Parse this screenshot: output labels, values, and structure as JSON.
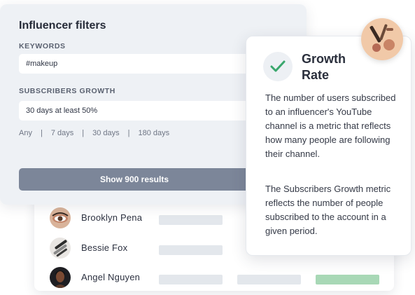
{
  "filters": {
    "title": "Influencer filters",
    "keywords_label": "KEYWORDS",
    "keywords_value": "#makeup",
    "growth_label": "SUBSCRIBERS GROWTH",
    "growth_value": "30 days at least 50%",
    "periods": [
      "Any",
      "7 days",
      "30 days",
      "180 days"
    ],
    "period_separator": "|",
    "show_button": "Show 900 results"
  },
  "influencers": [
    {
      "name": "Brooklyn Pena",
      "avatar_icon": "makeup-eye-photo-icon"
    },
    {
      "name": "Bessie Fox",
      "avatar_icon": "makeup-brush-photo-icon"
    },
    {
      "name": "Angel Nguyen",
      "avatar_icon": "woman-portrait-photo-icon"
    }
  ],
  "growth_card": {
    "icon": "check-icon",
    "title": "Growth Rate",
    "paragraph1": "The number of users subscribed to an influencer's YouTube channel is a metric that reflects how many people are following their channel.",
    "paragraph2": "The Subscribers Growth metric reflects the number of people subscribed to the account in a given period."
  },
  "colors": {
    "accent_green": "#3aa76d",
    "button": "#7c8699",
    "bar_gray": "#e3e7ec",
    "bar_green": "#a8d8b6"
  }
}
